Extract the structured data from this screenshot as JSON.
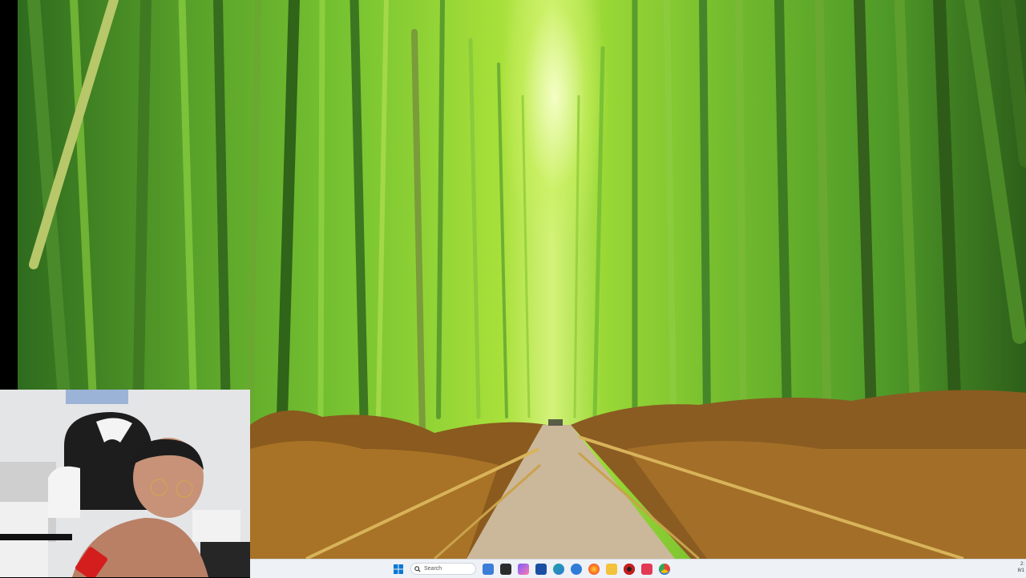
{
  "taskbar": {
    "search_label": "Search",
    "pinned_icons": [
      {
        "name": "start-icon",
        "color": "#0078d4"
      },
      {
        "name": "search-icon",
        "color": "#333333"
      },
      {
        "name": "widgets-icon",
        "color": "#3b7dd8"
      },
      {
        "name": "task-view-icon",
        "color": "#2b2b2b"
      },
      {
        "name": "copilot-icon",
        "color": "#7b5cff"
      },
      {
        "name": "calendar-app-icon",
        "color": "#1a4fa3"
      },
      {
        "name": "edge-browser-icon",
        "color": "#1fa3a0"
      },
      {
        "name": "app-icon",
        "color": "#2f7bd8"
      },
      {
        "name": "firefox-icon",
        "color": "#ff6a1a"
      },
      {
        "name": "file-explorer-icon",
        "color": "#f3c13a"
      },
      {
        "name": "app-red-icon",
        "color": "#c81e1e"
      },
      {
        "name": "app-pink-icon",
        "color": "#e23a54"
      },
      {
        "name": "chrome-icon",
        "color": "#34a853"
      }
    ],
    "tray_time": "2:",
    "tray_date": "8/1"
  }
}
